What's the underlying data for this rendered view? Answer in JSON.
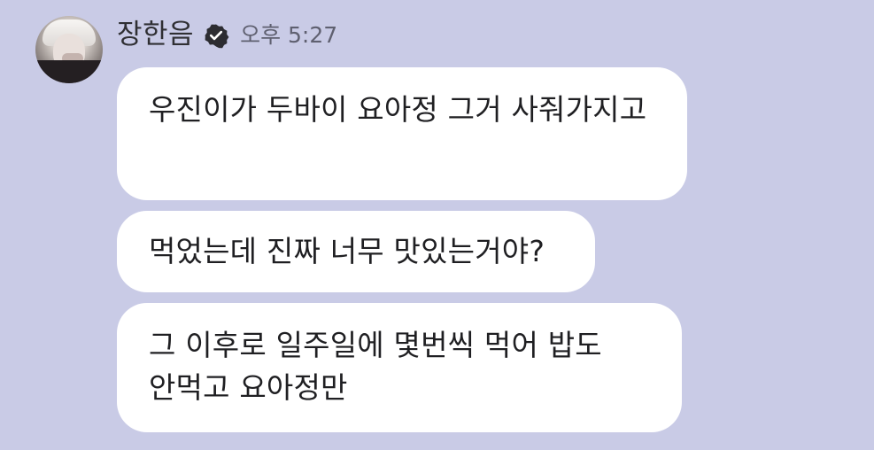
{
  "header": {
    "sender_name": "장한음",
    "timestamp": "오후 5:27",
    "verified_icon": "verified-check-icon"
  },
  "messages": [
    {
      "text": "우진이가 두바이 요아정 그거 사줘가지고"
    },
    {
      "text": "먹었는데 진짜 너무 맛있는거야?"
    },
    {
      "text": "그 이후로 일주일에 몇번씩 먹어 밥도 안먹고 요아정만"
    }
  ],
  "colors": {
    "background": "#c9cbe6",
    "bubble": "#ffffff",
    "text": "#1f1f22"
  }
}
